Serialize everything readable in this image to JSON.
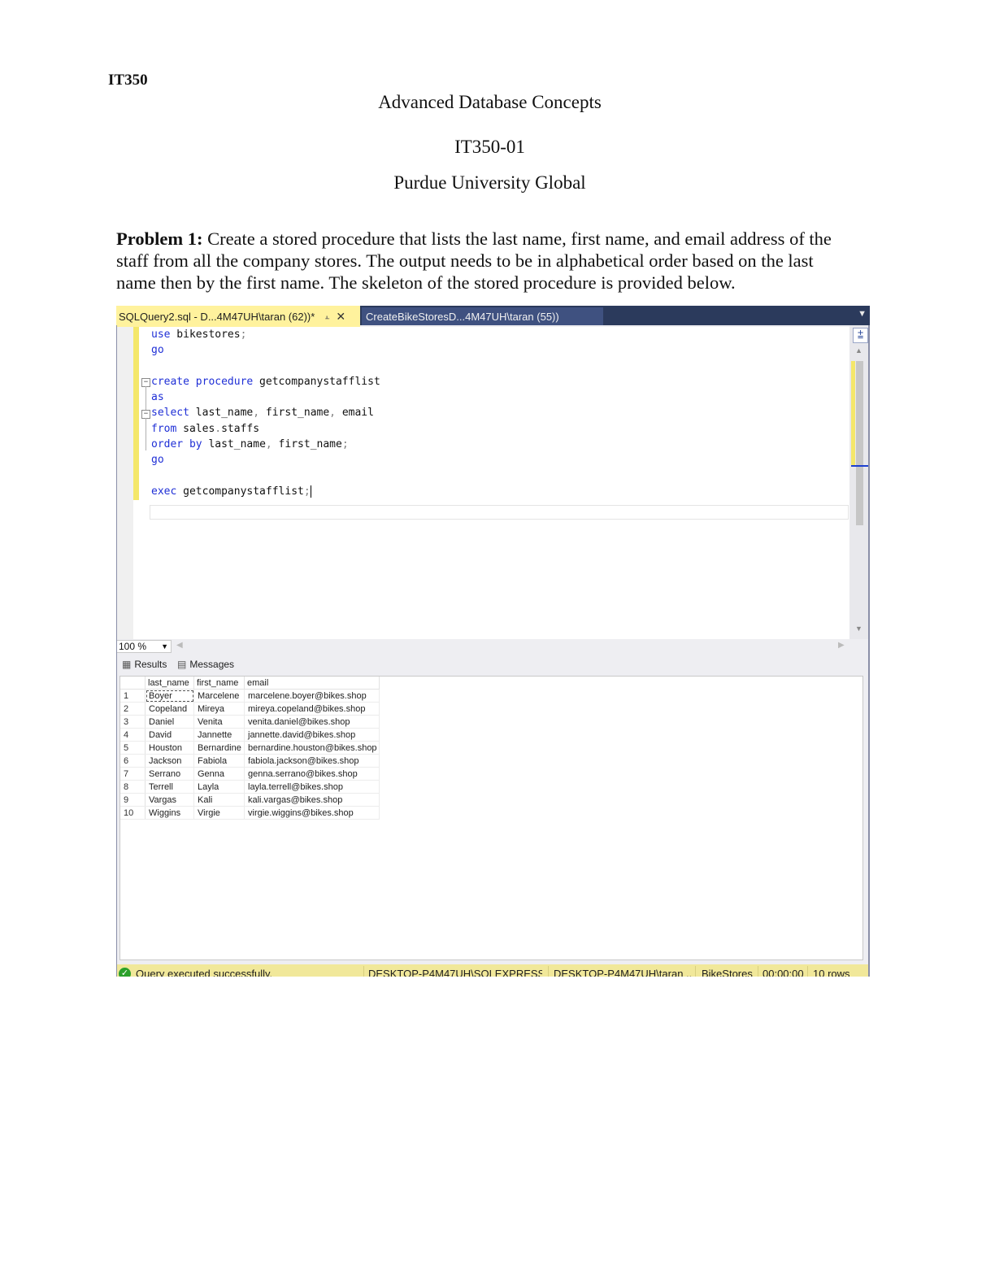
{
  "header": {
    "course_code": "IT350",
    "title": "Advanced Database Concepts",
    "section": "IT350-01",
    "university": "Purdue University Global"
  },
  "problem": {
    "label": "Problem 1:",
    "text": " Create a stored procedure that lists the last name, first name, and email address of the staff from all the company stores. The output needs to be in alphabetical order based on the last name then by the first name. The skeleton of the stored procedure is provided below."
  },
  "ssms": {
    "tabs": {
      "active": "SQLQuery2.sql - D...4M47UH\\taran (62))*",
      "inactive": "CreateBikeStoresD...4M47UH\\taran (55))"
    },
    "code": {
      "l1_kw": "use",
      "l1_rest": " bikestores",
      "l1_semi": ";",
      "l2": "go",
      "l4_kw": "create procedure",
      "l4_rest": " getcompanystafflist",
      "l5": "as",
      "l6_kw": "select",
      "l6_a": " last_name",
      "l6_c1": ",",
      "l6_b": " first_name",
      "l6_c2": ",",
      "l6_c": " email",
      "l7_kw": "from",
      "l7_a": " sales",
      "l7_dot": ".",
      "l7_b": "staffs",
      "l8_kw": "order by",
      "l8_a": " last_name",
      "l8_c": ",",
      "l8_b": " first_name",
      "l8_semi": ";",
      "l9": "go",
      "l11_kw": "exec",
      "l11_rest": " getcompanystafflist",
      "l11_semi": ";"
    },
    "zoom": "100 %",
    "results_tab": "Results",
    "messages_tab": "Messages",
    "grid": {
      "columns": [
        "last_name",
        "first_name",
        "email"
      ],
      "rows": [
        {
          "n": "1",
          "last_name": "Boyer",
          "first_name": "Marcelene",
          "email": "marcelene.boyer@bikes.shop"
        },
        {
          "n": "2",
          "last_name": "Copeland",
          "first_name": "Mireya",
          "email": "mireya.copeland@bikes.shop"
        },
        {
          "n": "3",
          "last_name": "Daniel",
          "first_name": "Venita",
          "email": "venita.daniel@bikes.shop"
        },
        {
          "n": "4",
          "last_name": "David",
          "first_name": "Jannette",
          "email": "jannette.david@bikes.shop"
        },
        {
          "n": "5",
          "last_name": "Houston",
          "first_name": "Bernardine",
          "email": "bernardine.houston@bikes.shop"
        },
        {
          "n": "6",
          "last_name": "Jackson",
          "first_name": "Fabiola",
          "email": "fabiola.jackson@bikes.shop"
        },
        {
          "n": "7",
          "last_name": "Serrano",
          "first_name": "Genna",
          "email": "genna.serrano@bikes.shop"
        },
        {
          "n": "8",
          "last_name": "Terrell",
          "first_name": "Layla",
          "email": "layla.terrell@bikes.shop"
        },
        {
          "n": "9",
          "last_name": "Vargas",
          "first_name": "Kali",
          "email": "kali.vargas@bikes.shop"
        },
        {
          "n": "10",
          "last_name": "Wiggins",
          "first_name": "Virgie",
          "email": "virgie.wiggins@bikes.shop"
        }
      ]
    },
    "status": {
      "message": "Query executed successfully.",
      "server": "DESKTOP-P4M47UH\\SQLEXPRESS ...",
      "user": "DESKTOP-P4M47UH\\taran ...",
      "database": "BikeStores",
      "elapsed": "00:00:00",
      "rows": "10 rows"
    },
    "colors": {
      "tab_active": "#fff29d",
      "tab_bar": "#2b3a5c",
      "keyword": "#1f2fd6",
      "status_bar": "#f1e89a"
    },
    "icons": [
      "pin-icon",
      "close-icon",
      "dropdown-icon",
      "split-icon",
      "grid-icon",
      "messages-icon",
      "check-icon"
    ]
  }
}
